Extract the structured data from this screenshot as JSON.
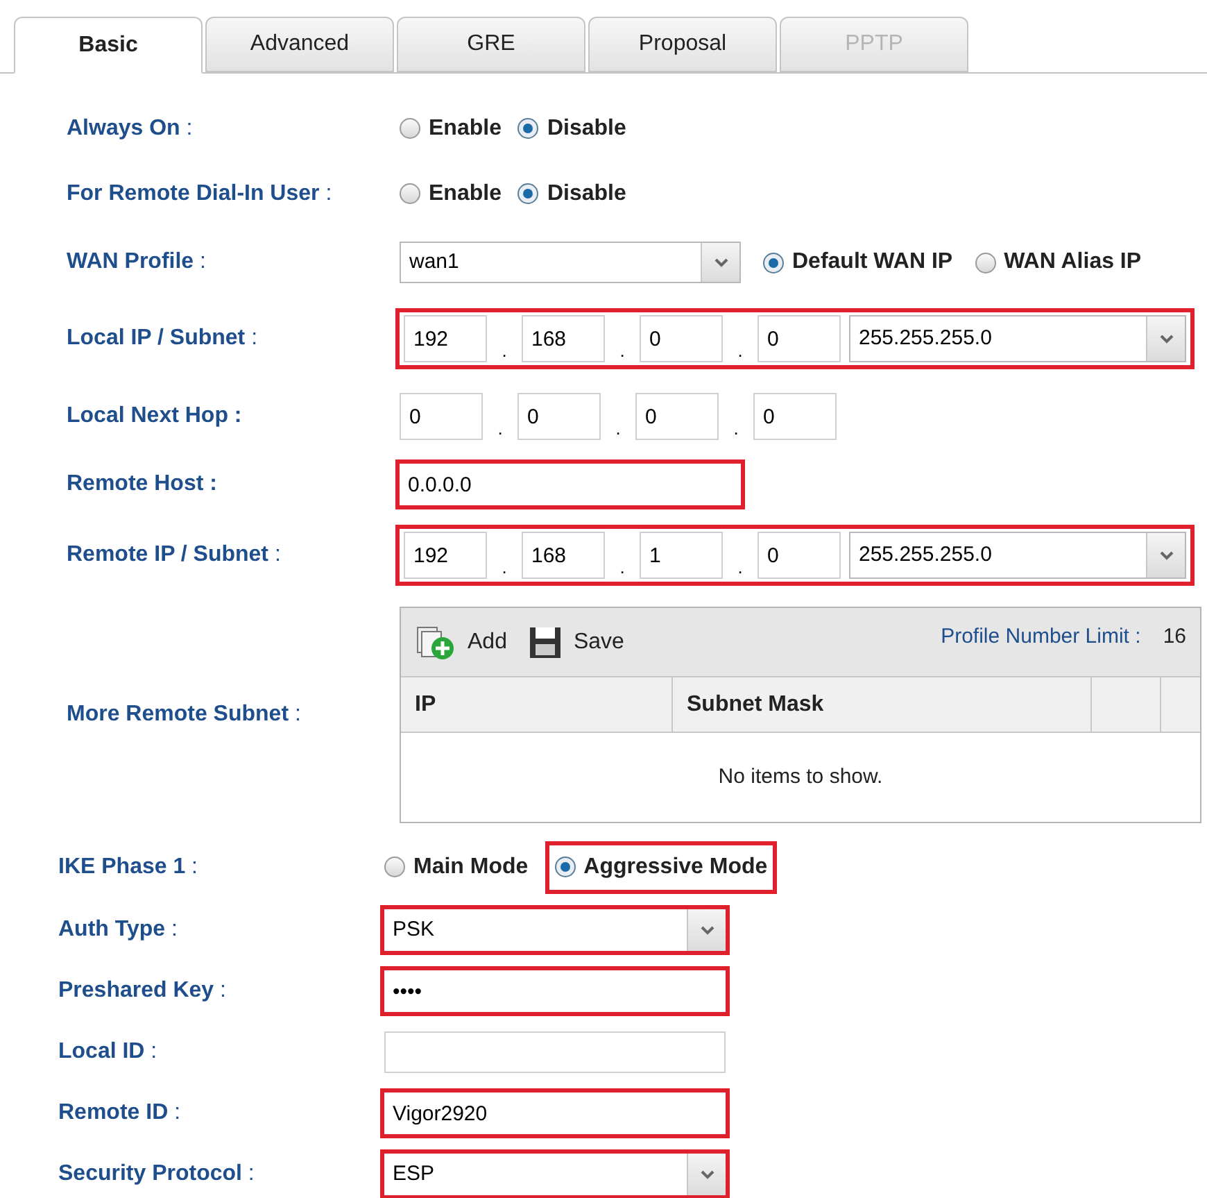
{
  "tabs": [
    {
      "label": "Basic",
      "selected": true,
      "disabled": false
    },
    {
      "label": "Advanced",
      "selected": false,
      "disabled": false
    },
    {
      "label": "GRE",
      "selected": false,
      "disabled": false
    },
    {
      "label": "Proposal",
      "selected": false,
      "disabled": false
    },
    {
      "label": "PPTP",
      "selected": false,
      "disabled": true
    }
  ],
  "rows": [
    {
      "kind": "radio",
      "label": "**Always On** :",
      "options": [
        {
          "label": "Enable",
          "selected": false,
          "highlighted": false
        },
        {
          "label": "Disable",
          "selected": true,
          "highlighted": false
        }
      ]
    },
    {
      "kind": "radio",
      "label": "**For Remote Dial-In User** :",
      "options": [
        {
          "label": "Enable",
          "selected": false,
          "highlighted": false
        },
        {
          "label": "Disable",
          "selected": true,
          "highlighted": false
        }
      ]
    },
    {
      "kind": "select_radio",
      "label": "**WAN Profile** :",
      "value": "wan1",
      "options": [
        {
          "label": "Default WAN IP",
          "selected": true,
          "highlighted": false
        },
        {
          "label": "WAN Alias IP",
          "selected": false,
          "highlighted": false
        }
      ]
    },
    {
      "kind": "ip_subnet",
      "label": "**Local IP / Subnet** :",
      "octets": [
        "192",
        "168",
        "0",
        "0"
      ],
      "separator": ".",
      "mask": "255.255.255.0",
      "highlighted": true
    },
    {
      "kind": "ip",
      "label": "**Local Next Hop :**",
      "octets": [
        "0",
        "0",
        "0",
        "0"
      ],
      "separator": ".",
      "highlighted": false
    },
    {
      "kind": "text",
      "label": "**Remote Host :**",
      "value": "0.0.0.0",
      "highlighted": true
    },
    {
      "kind": "ip_subnet",
      "label": "**Remote IP / Subnet** :",
      "octets": [
        "192",
        "168",
        "1",
        "0"
      ],
      "separator": ".",
      "mask": "255.255.255.0",
      "highlighted": true
    },
    {
      "kind": "grid",
      "label": "**More Remote Subnet** :",
      "toolbar": [
        {
          "label": "Add",
          "kind": "add"
        },
        {
          "label": "Save",
          "kind": "save"
        }
      ],
      "limit_label": "Profile Number Limit :",
      "limit": "16",
      "columns": [
        "IP",
        "Subnet Mask"
      ],
      "empty_text": "No items to show."
    },
    {
      "kind": "radio",
      "label": "**IKE Phase 1** :",
      "options": [
        {
          "label": "Main Mode",
          "selected": false,
          "highlighted": false
        },
        {
          "label": "Aggressive Mode",
          "selected": true,
          "highlighted": true
        }
      ]
    },
    {
      "kind": "select",
      "label": "**Auth Type** :",
      "value": "PSK",
      "highlighted": true
    },
    {
      "kind": "text",
      "label": "**Preshared Key** :",
      "value": "••••",
      "highlighted": true
    },
    {
      "kind": "text",
      "label": "**Local ID** :",
      "highlighted": false
    },
    {
      "kind": "text",
      "label": "**Remote ID** :",
      "value": "Vigor2920",
      "highlighted": true
    },
    {
      "kind": "select",
      "label": "**Security Protocol** :",
      "value": "ESP",
      "highlighted": true
    }
  ]
}
